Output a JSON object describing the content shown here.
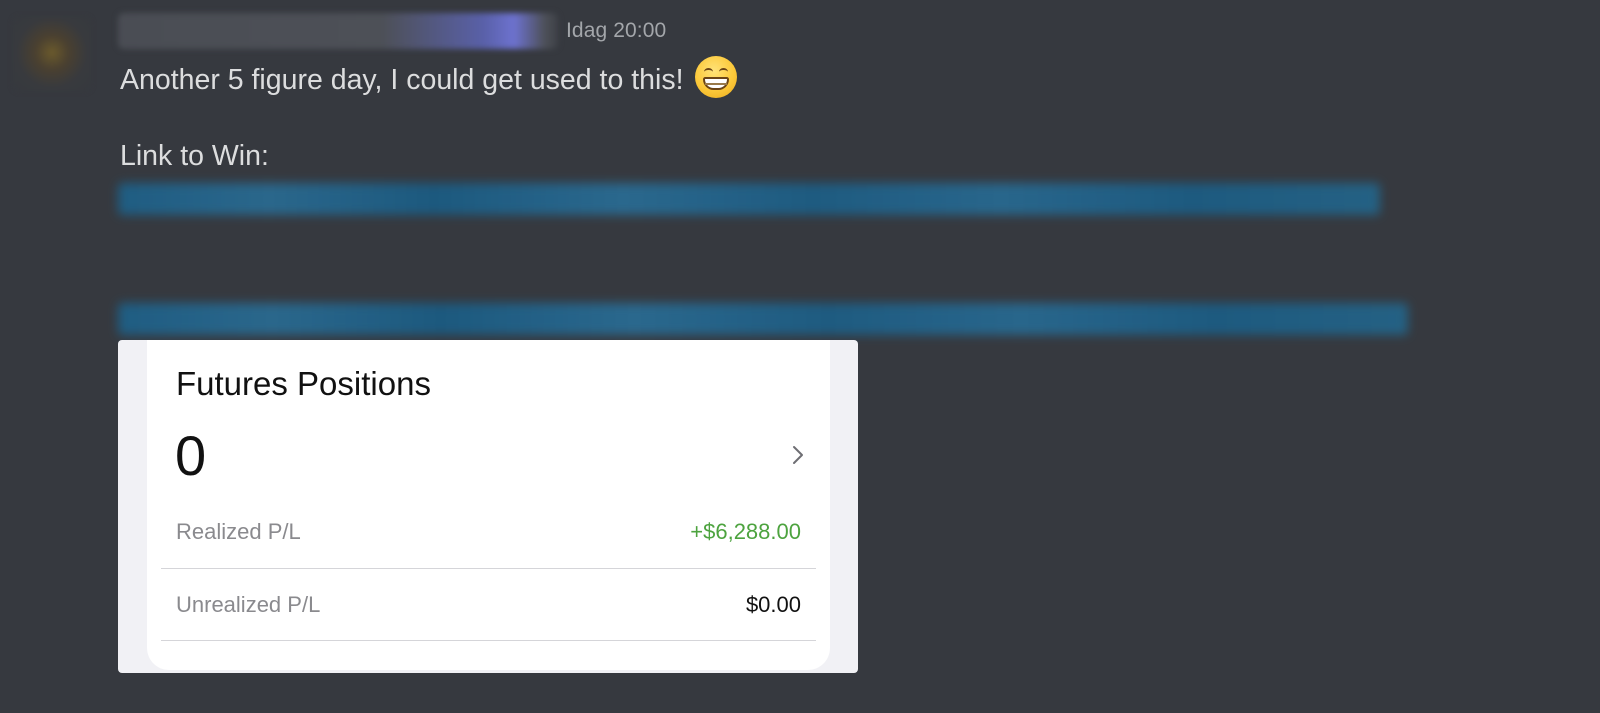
{
  "message": {
    "author": {
      "avatar_icon": "avatar-icon",
      "username_redacted": true
    },
    "timestamp": "Idag 20:00",
    "text_line1": "Another 5 figure day, I could get used to this!",
    "emoji": "grinning-face-with-smiling-eyes",
    "text_line2": "Link to Win:",
    "redacted_links": 2
  },
  "attachment": {
    "title": "Futures Positions",
    "count": "0",
    "chevron_icon": "chevron-right-icon",
    "rows": [
      {
        "label": "Realized P/L",
        "value": "+$6,288.00",
        "color": "#4da33f"
      },
      {
        "label": "Unrealized P/L",
        "value": "$0.00",
        "color": "#111111"
      }
    ]
  },
  "colors": {
    "background": "#36393f",
    "message_text": "#dcddde",
    "timestamp": "#a3a6aa",
    "link": "#00aff4"
  }
}
